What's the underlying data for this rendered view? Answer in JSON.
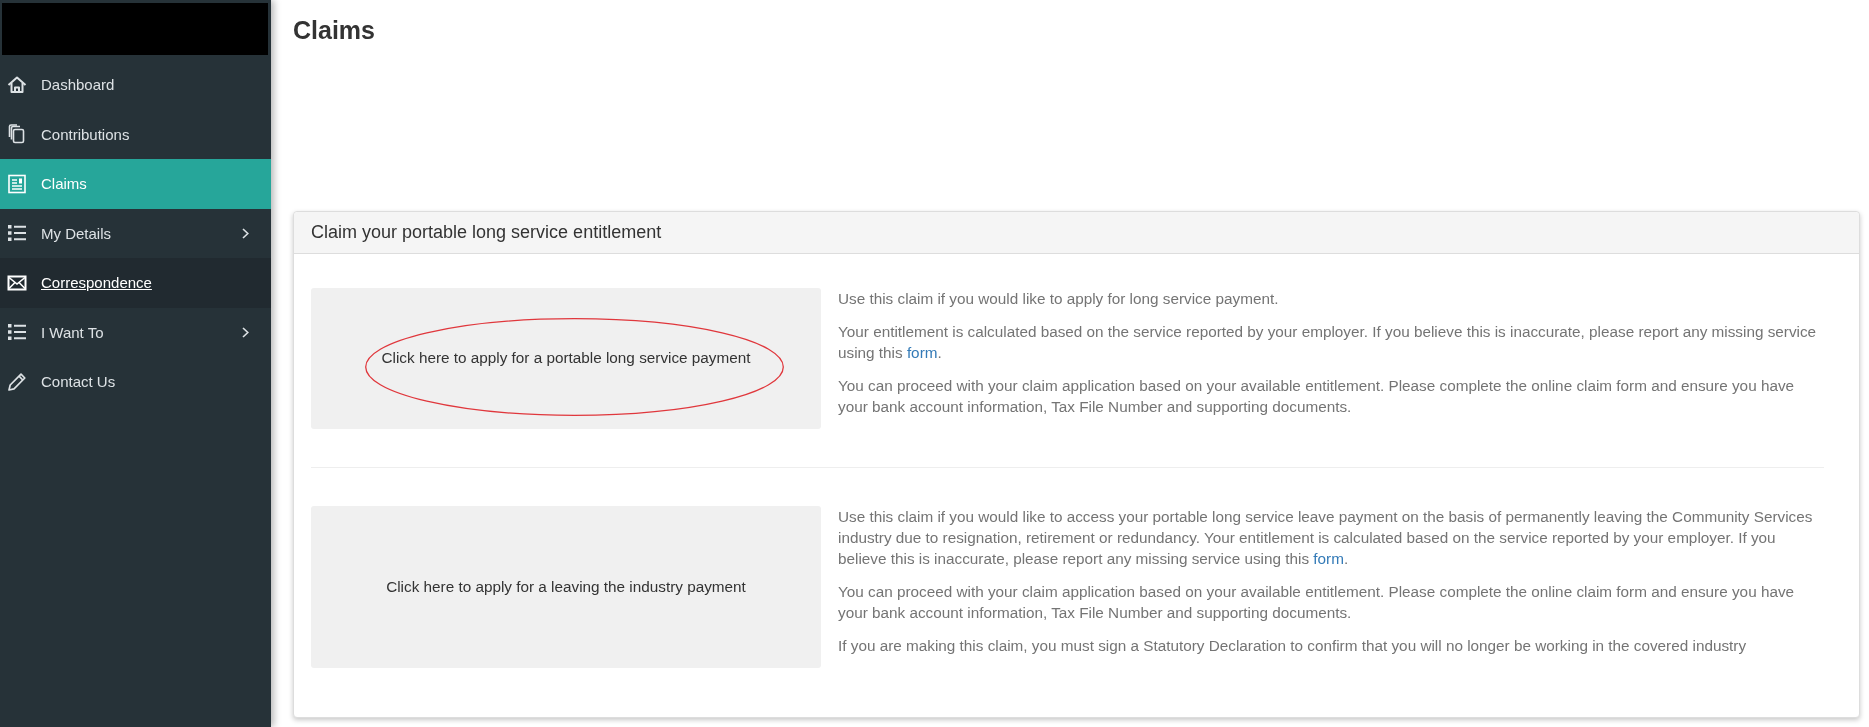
{
  "sidebar": {
    "items": [
      {
        "label": "Dashboard",
        "selected": false,
        "hovered": false,
        "expandable": false
      },
      {
        "label": "Contributions",
        "selected": false,
        "hovered": false,
        "expandable": false
      },
      {
        "label": "Claims",
        "selected": true,
        "hovered": false,
        "expandable": false
      },
      {
        "label": "My Details",
        "selected": false,
        "hovered": false,
        "expandable": true
      },
      {
        "label": "Correspondence",
        "selected": false,
        "hovered": true,
        "expandable": false
      },
      {
        "label": "I Want To",
        "selected": false,
        "hovered": false,
        "expandable": true
      },
      {
        "label": "Contact Us",
        "selected": false,
        "hovered": false,
        "expandable": false
      }
    ]
  },
  "page": {
    "title": "Claims"
  },
  "card": {
    "title": "Claim your portable long service entitlement",
    "options": [
      {
        "button": "Click here to apply for a portable long service payment",
        "circled": true,
        "paragraphs": [
          [
            {
              "kind": "text",
              "text": "Use this claim if you would like to apply for long service payment."
            }
          ],
          [
            {
              "kind": "text",
              "text": "Your entitlement is calculated based on the service reported by your employer. If you believe this is inaccurate, please report any missing service using this "
            },
            {
              "kind": "link",
              "text": "form"
            },
            {
              "kind": "text",
              "text": "."
            }
          ],
          [
            {
              "kind": "text",
              "text": "You can proceed with your claim application based on your available entitlement. Please complete the online claim form and ensure you have your bank account information, Tax File Number and supporting documents."
            }
          ]
        ]
      },
      {
        "button": "Click here to apply for a leaving the industry payment",
        "circled": false,
        "paragraphs": [
          [
            {
              "kind": "text",
              "text": "Use this claim if you would like to access your portable long service leave payment on the basis of permanently leaving the Community Services industry due to resignation, retirement or redundancy. Your entitlement is calculated based on the service reported by your employer. If you believe this is inaccurate, please report any missing service using this "
            },
            {
              "kind": "link",
              "text": "form"
            },
            {
              "kind": "text",
              "text": "."
            }
          ],
          [
            {
              "kind": "text",
              "text": "You can proceed with your claim application based on your available entitlement. Please complete the online claim form and ensure you have your bank account information, Tax File Number and supporting documents."
            }
          ],
          [
            {
              "kind": "text",
              "text": "If you are making this claim, you must sign a Statutory Declaration to confirm that you will no longer be working in the covered industry"
            }
          ]
        ]
      }
    ]
  }
}
